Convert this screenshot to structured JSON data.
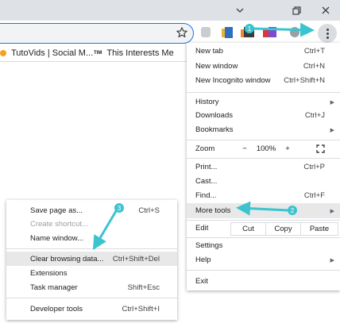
{
  "bookmarks": [
    {
      "label": "TutoVids | Social M...",
      "favicon": "orange-circle-favicon"
    },
    {
      "label": "This Interests Me",
      "favicon": "tim-favicon",
      "favicon_text": "TIM"
    }
  ],
  "menu": {
    "new_tab": {
      "label": "New tab",
      "shortcut": "Ctrl+T"
    },
    "new_window": {
      "label": "New window",
      "shortcut": "Ctrl+N"
    },
    "incognito": {
      "label": "New Incognito window",
      "shortcut": "Ctrl+Shift+N"
    },
    "history": {
      "label": "History"
    },
    "downloads": {
      "label": "Downloads",
      "shortcut": "Ctrl+J"
    },
    "bookmarks": {
      "label": "Bookmarks"
    },
    "zoom": {
      "label": "Zoom",
      "minus": "−",
      "value": "100%",
      "plus": "+"
    },
    "print": {
      "label": "Print...",
      "shortcut": "Ctrl+P"
    },
    "cast": {
      "label": "Cast..."
    },
    "find": {
      "label": "Find...",
      "shortcut": "Ctrl+F"
    },
    "more_tools": {
      "label": "More tools"
    },
    "edit": {
      "label": "Edit",
      "cut": "Cut",
      "copy": "Copy",
      "paste": "Paste"
    },
    "settings": {
      "label": "Settings"
    },
    "help": {
      "label": "Help"
    },
    "exit": {
      "label": "Exit"
    }
  },
  "submenu": {
    "save_page": {
      "label": "Save page as...",
      "shortcut": "Ctrl+S"
    },
    "create_shortcut": {
      "label": "Create shortcut..."
    },
    "name_window": {
      "label": "Name window..."
    },
    "clear_data": {
      "label": "Clear browsing data...",
      "shortcut": "Ctrl+Shift+Del"
    },
    "extensions": {
      "label": "Extensions"
    },
    "task_manager": {
      "label": "Task manager",
      "shortcut": "Shift+Esc"
    },
    "developer_tools": {
      "label": "Developer tools",
      "shortcut": "Ctrl+Shift+I"
    }
  },
  "annotations": {
    "steps": [
      "1",
      "2",
      "3"
    ],
    "arrow_color": "#3bc4cf"
  },
  "colors": {
    "titlebar": "#dee1e6",
    "highlight": "#e8e8e8",
    "omnibox_border": "#1a73e8"
  }
}
